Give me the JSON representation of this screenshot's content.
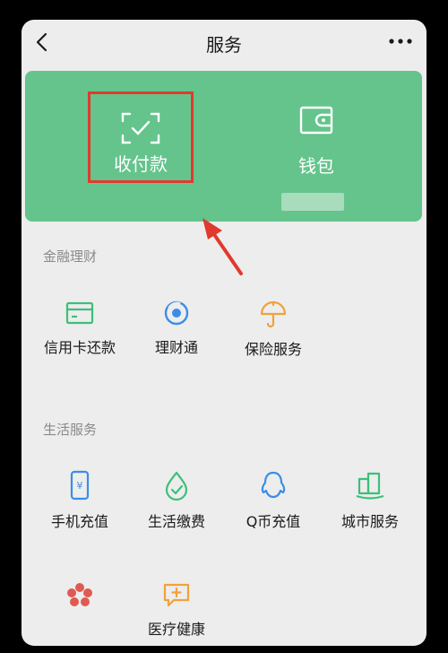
{
  "header": {
    "title": "服务"
  },
  "main_card": {
    "pay": {
      "label": "收付款"
    },
    "wallet": {
      "label": "钱包"
    }
  },
  "sections": {
    "finance": {
      "title": "金融理财",
      "items": [
        {
          "label": "信用卡还款"
        },
        {
          "label": "理财通"
        },
        {
          "label": "保险服务"
        }
      ]
    },
    "life": {
      "title": "生活服务",
      "items": [
        {
          "label": "手机充值"
        },
        {
          "label": "生活缴费"
        },
        {
          "label": "Q币充值"
        },
        {
          "label": "城市服务"
        },
        {
          "label": ""
        },
        {
          "label": "医疗健康"
        }
      ]
    }
  },
  "colors": {
    "card_green": "#64c48c",
    "highlight_red": "#e03a2e",
    "finance_icon": "#3dbf7a",
    "life_icon_blue": "#3a8ee6",
    "orange": "#f0a23b",
    "red_icon": "#e05a52"
  },
  "icons": {
    "back": "chevron-left-icon",
    "more": "ellipsis-icon",
    "pay": "scan-check-icon",
    "wallet": "wallet-icon"
  }
}
